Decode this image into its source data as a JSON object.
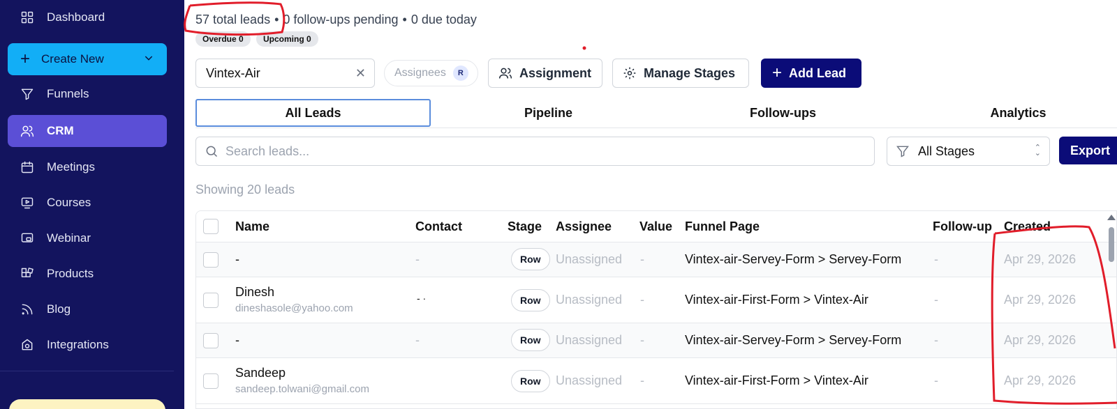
{
  "sidebar": {
    "create_new_label": "Create New",
    "items": [
      {
        "label": "Dashboard",
        "icon": "grid-icon"
      },
      {
        "label": "Funnels",
        "icon": "funnel-icon"
      },
      {
        "label": "CRM",
        "icon": "users-icon",
        "active": true
      },
      {
        "label": "Meetings",
        "icon": "calendar-icon"
      },
      {
        "label": "Courses",
        "icon": "play-screen-icon"
      },
      {
        "label": "Webinar",
        "icon": "webinar-icon"
      },
      {
        "label": "Products",
        "icon": "boxes-icon"
      },
      {
        "label": "Blog",
        "icon": "rss-icon"
      },
      {
        "label": "Integrations",
        "icon": "plug-icon"
      }
    ]
  },
  "summary": {
    "total": "57 total leads",
    "pending": "0 follow-ups pending",
    "due": "0 due today",
    "overdue_badge": "Overdue 0",
    "upcoming_badge": "Upcoming 0"
  },
  "toolbar": {
    "funnel_value": "Vintex-Air",
    "assignees_label": "Assignees",
    "assignee_initial": "R",
    "assignment_label": "Assignment",
    "manage_stages_label": "Manage Stages",
    "add_lead_label": "Add Lead"
  },
  "tabs": [
    "All Leads",
    "Pipeline",
    "Follow-ups",
    "Analytics"
  ],
  "filters": {
    "search_placeholder": "Search leads...",
    "stage_value": "All Stages",
    "export_label": "Export"
  },
  "showing_text": "Showing 20 leads",
  "table": {
    "columns": [
      "Name",
      "Contact",
      "Stage",
      "Assignee",
      "Value",
      "Funnel Page",
      "Follow-up",
      "Created"
    ],
    "rows": [
      {
        "name": "-",
        "email": "",
        "contact": "-",
        "stage": "Row",
        "assignee": "Unassigned",
        "value": "-",
        "funnel_page": "Vintex-air-Servey-Form > Servey-Form",
        "follow_up": "-",
        "created": "Apr 29, 2026"
      },
      {
        "name": "Dinesh",
        "email": "dineshasole@yahoo.com",
        "contact": "- ·",
        "stage": "Row",
        "assignee": "Unassigned",
        "value": "-",
        "funnel_page": "Vintex-air-First-Form > Vintex-Air",
        "follow_up": "-",
        "created": "Apr 29, 2026"
      },
      {
        "name": "-",
        "email": "",
        "contact": "-",
        "stage": "Row",
        "assignee": "Unassigned",
        "value": "-",
        "funnel_page": "Vintex-air-Servey-Form > Servey-Form",
        "follow_up": "-",
        "created": "Apr 29, 2026"
      },
      {
        "name": "Sandeep",
        "email": "sandeep.tolwani@gmail.com",
        "contact": "",
        "stage": "Row",
        "assignee": "Unassigned",
        "value": "-",
        "funnel_page": "Vintex-air-First-Form > Vintex-Air",
        "follow_up": "-",
        "created": "Apr 29, 2026"
      }
    ]
  },
  "colors": {
    "sidebar_bg": "#13145e",
    "active_nav": "#5b4fd6",
    "create_btn": "#12aef6",
    "primary_btn": "#0b0c78",
    "annotation_red": "#e11d2a"
  }
}
